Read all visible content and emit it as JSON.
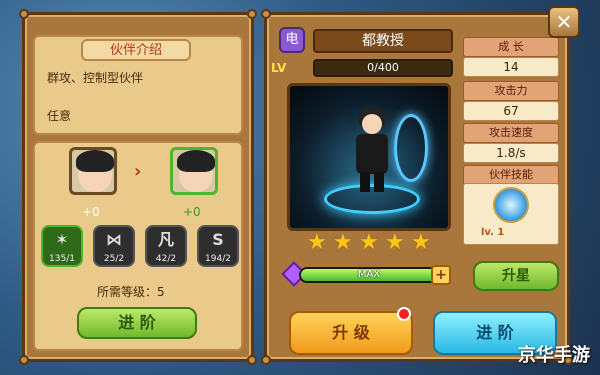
{
  "left_panel": {
    "title": "伙伴介绍",
    "description": "群攻、控制型伙伴",
    "description2": "任意",
    "current_plus": "+0",
    "next_plus": "+0",
    "runes": [
      {
        "symbol": "✶",
        "count": "135/1"
      },
      {
        "symbol": "⋈",
        "count": "25/2"
      },
      {
        "symbol": "凡",
        "count": "42/2"
      },
      {
        "symbol": "S",
        "count": "194/2"
      }
    ],
    "required_level_label": "所需等级：5",
    "advance_button": "进 阶"
  },
  "right_panel": {
    "element_badge": "电",
    "name": "都教授",
    "level_label": "LV",
    "exp_text": "0/400",
    "stars": 5,
    "star_max": 5,
    "max_label": "MAX",
    "star_up_button": "升星",
    "upgrade_button": "升 级",
    "advance_button": "进 阶",
    "stats": {
      "growth_label": "成 长",
      "growth_value": "14",
      "attack_label": "攻击力",
      "attack_value": "67",
      "speed_label": "攻击速度",
      "speed_value": "1.8/s",
      "skill_label": "伙伴技能",
      "skill_level": "lv. 1"
    }
  },
  "close_button": "✕",
  "watermark": "京华手游",
  "colors": {
    "accent": "#b03a1a",
    "panel": "#a9763b"
  }
}
